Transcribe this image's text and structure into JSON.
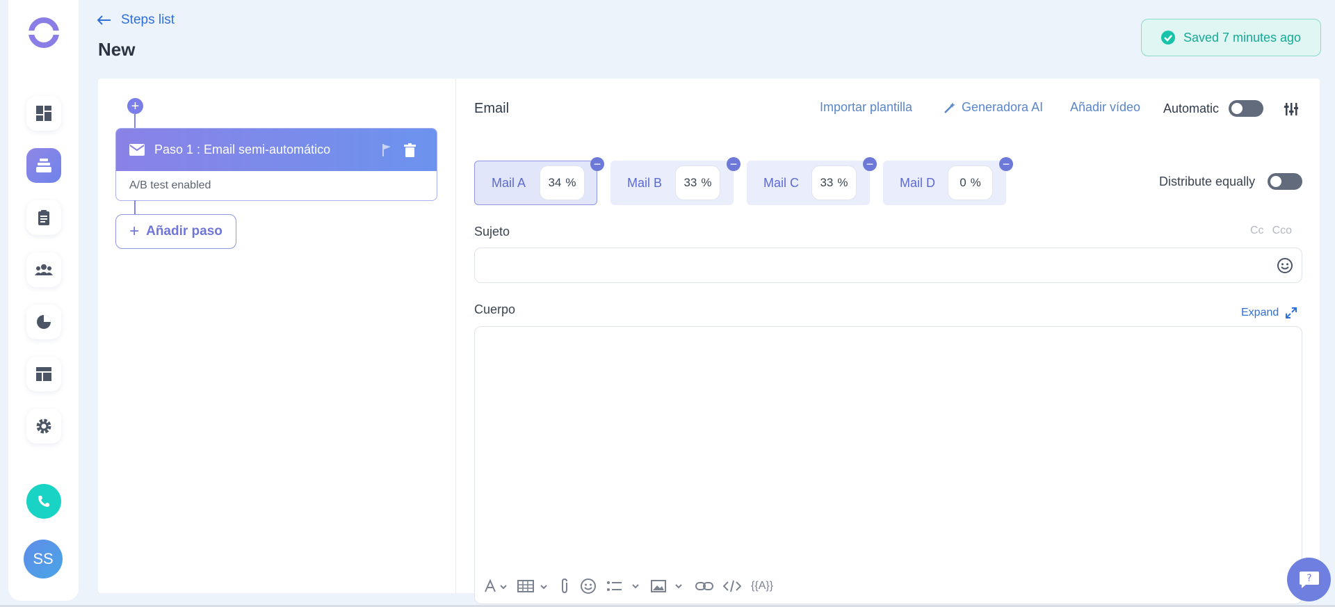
{
  "header": {
    "back_label": "Steps list",
    "title": "New",
    "saved_status": "Saved 7 minutes ago"
  },
  "sidebar": {
    "items": [
      {
        "icon": "dashboard-icon"
      },
      {
        "icon": "sequences-icon",
        "active": true
      },
      {
        "icon": "clipboard-icon"
      },
      {
        "icon": "people-icon"
      },
      {
        "icon": "pie-chart-icon"
      },
      {
        "icon": "layout-icon"
      },
      {
        "icon": "gear-icon"
      }
    ],
    "avatar_initials": "SS"
  },
  "steps": {
    "step1_title": "Paso 1 : Email semi-automático",
    "step1_subtitle": "A/B test enabled",
    "add_step_label": "Añadir paso"
  },
  "email": {
    "section_label": "Email",
    "import_template": "Importar plantilla",
    "ai_generator": "Generadora AI",
    "add_video": "Añadir vídeo",
    "automatic_label": "Automatic",
    "variants": [
      {
        "name": "Mail A",
        "percent": "34",
        "unit": "%"
      },
      {
        "name": "Mail B",
        "percent": "33",
        "unit": "%"
      },
      {
        "name": "Mail C",
        "percent": "33",
        "unit": "%"
      },
      {
        "name": "Mail D",
        "percent": "0",
        "unit": "%"
      }
    ],
    "distribute_label": "Distribute equally",
    "subject_label": "Sujeto",
    "cc_label": "Cc",
    "cco_label": "Cco",
    "body_label": "Cuerpo",
    "expand_label": "Expand",
    "variable_token": "{{A}}"
  },
  "colors": {
    "accent": "#7b7ee8",
    "link": "#2f6fd9",
    "success": "#17a895"
  }
}
